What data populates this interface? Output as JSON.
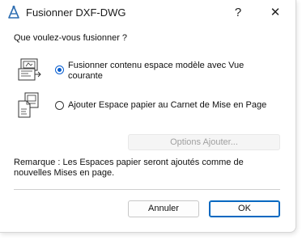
{
  "window": {
    "title": "Fusionner DXF-DWG",
    "help_label": "?",
    "close_label": "✕"
  },
  "prompt": "Que voulez-vous fusionner ?",
  "options": [
    {
      "label": "Fusionner contenu espace modèle avec Vue courante",
      "selected": true
    },
    {
      "label": "Ajouter Espace papier au Carnet de Mise en Page",
      "selected": false
    }
  ],
  "options_button": "Options Ajouter...",
  "remark": "Remarque : Les Espaces papier seront ajoutés comme de nouvelles Mises en page.",
  "buttons": {
    "cancel": "Annuler",
    "ok": "OK"
  },
  "colors": {
    "accent": "#0a5fd0",
    "disabled_text": "#a0a0a0"
  }
}
